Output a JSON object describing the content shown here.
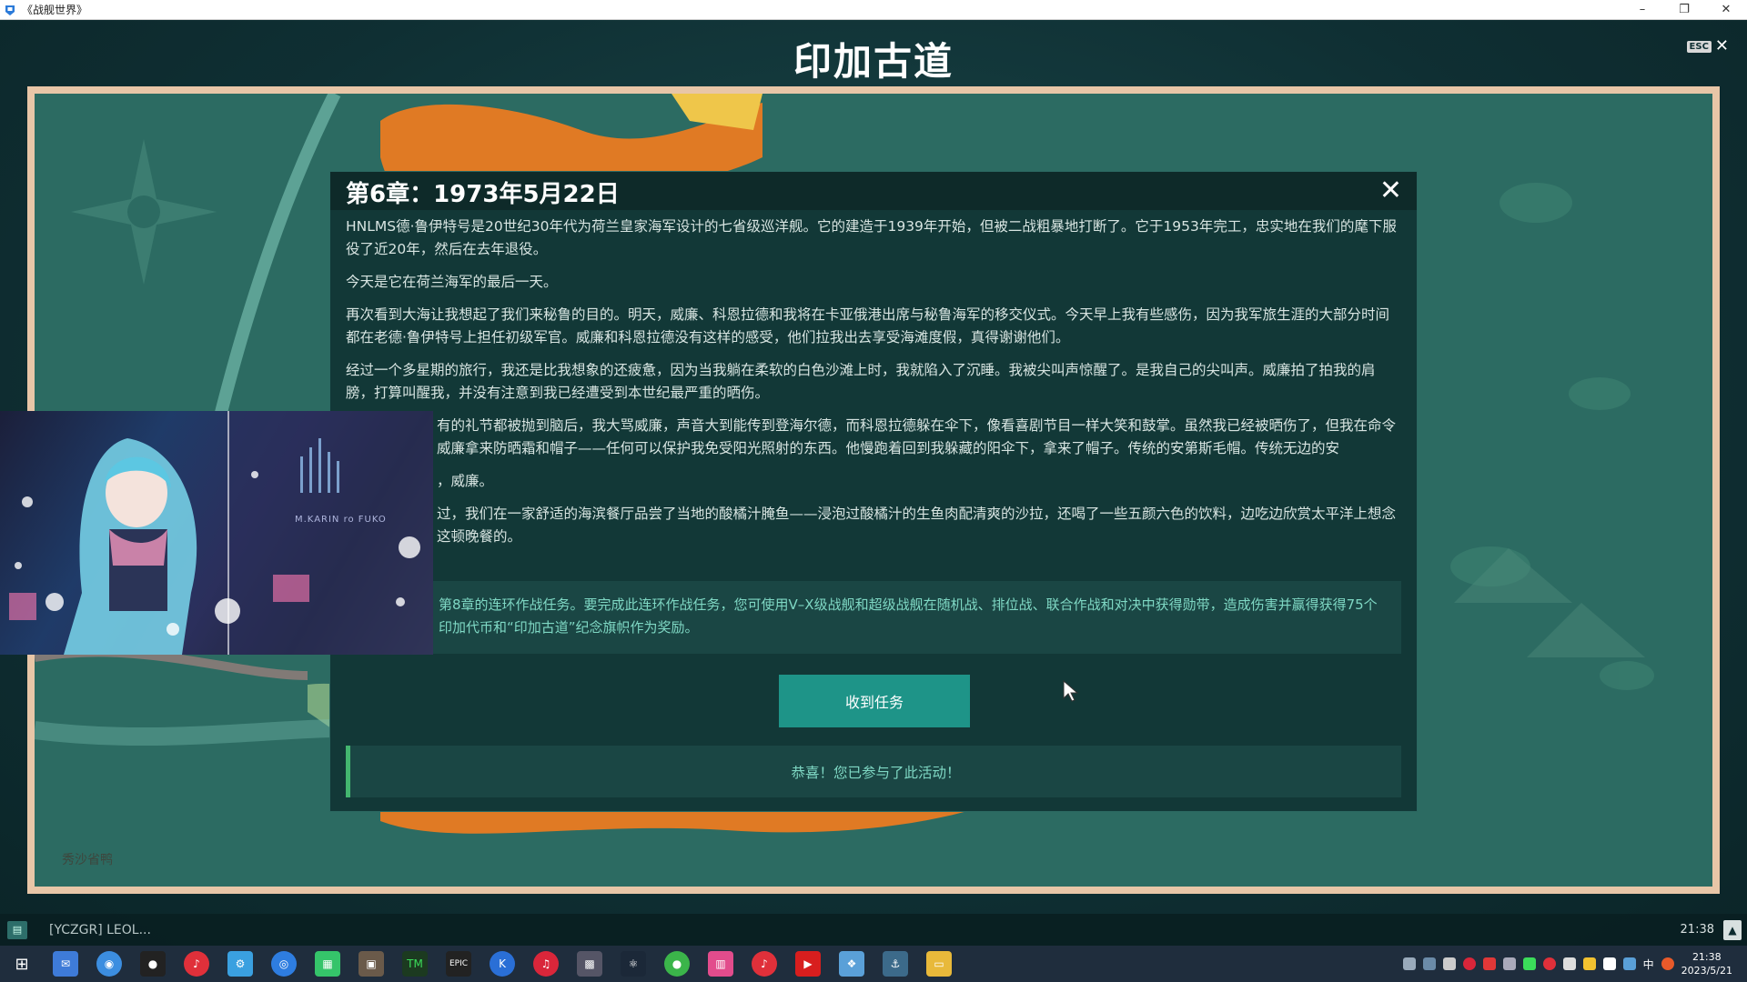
{
  "window": {
    "title": "《战舰世界》",
    "minimize": "–",
    "restore": "❐",
    "close": "✕"
  },
  "header": {
    "title": "印加古道",
    "esc_key": "ESC",
    "close_glyph": "✕"
  },
  "map": {
    "label": "秀沙省鸭"
  },
  "dialog": {
    "title": "第6章：1973年5月22日",
    "close_glyph": "✕",
    "paragraphs": [
      "HNLMS德·鲁伊特号是20世纪30年代为荷兰皇家海军设计的七省级巡洋舰。它的建造于1939年开始，但被二战粗暴地打断了。它于1953年完工，忠实地在我们的麾下服役了近20年，然后在去年退役。",
      "今天是它在荷兰海军的最后一天。",
      "再次看到大海让我想起了我们来秘鲁的目的。明天，威廉、科恩拉德和我将在卡亚俄港出席与秘鲁海军的移交仪式。今天早上我有些感伤，因为我军旅生涯的大部分时间都在老德·鲁伊特号上担任初级军官。威廉和科恩拉德没有这样的感受，他们拉我出去享受海滩度假，真得谢谢他们。",
      "经过一个多星期的旅行，我还是比我想象的还疲惫，因为当我躺在柔软的白色沙滩上时，我就陷入了沉睡。我被尖叫声惊醒了。是我自己的尖叫声。威廉拍了拍我的肩膀，打算叫醒我，并没有注意到我已经遭受到本世纪最严重的晒伤。",
      "有的礼节都被抛到脑后，我大骂威廉，声音大到能传到登海尔德，而科恩拉德躲在伞下，像看喜剧节目一样大笑和鼓掌。虽然我已经被晒伤了，但我在命令威廉拿来防晒霜和帽子——任何可以保护我免受阳光照射的东西。他慢跑着回到我躲藏的阳伞下，拿来了帽子。传统的安第斯毛帽。传统无边的安",
      "，威廉。",
      "过，我们在一家舒适的海滨餐厅品尝了当地的酸橘汁腌鱼——浸泡过酸橘汁的生鱼肉配清爽的沙拉，还喝了一些五颜六色的饮料，边吃边欣赏太平洋上想念这顿晚餐的。"
    ],
    "notice": "第8章的连环作战任务。要完成此连环作战任务，您可使用V–X级战舰和超级战舰在随机战、排位战、联合作战和对决中获得勋带，造成伤害并赢得获得75个印加代币和“印加古道”纪念旗帜作为奖励。",
    "receive_button": "收到任务",
    "participated": "恭喜！您已参与了此活动！"
  },
  "wallpaper": {
    "caption": "M.KARIN ro FUKO"
  },
  "chat": {
    "clan_tag": "[YCZGR]  LEOL...",
    "time": "21:38"
  },
  "taskbar": {
    "clock_time": "21:38",
    "clock_date": "2023/5/21",
    "ime": "中"
  }
}
